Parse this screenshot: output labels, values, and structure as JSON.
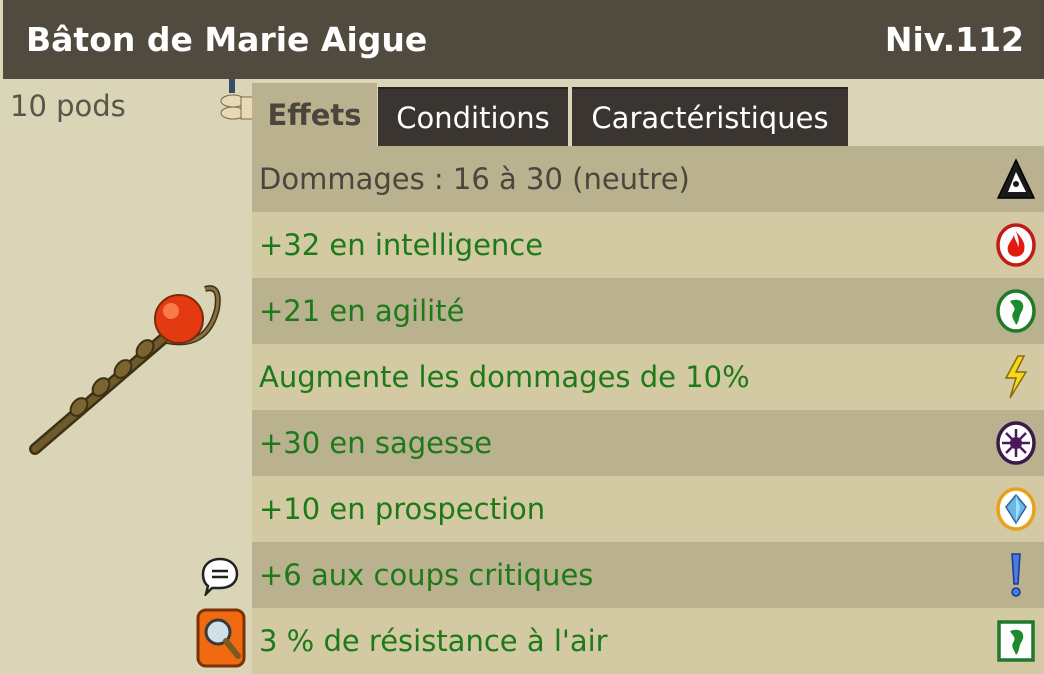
{
  "item": {
    "name": "Bâton de Marie Aigue",
    "level": "Niv.112",
    "weight": "10 pods"
  },
  "tabs": [
    {
      "label": "Effets",
      "active": true
    },
    {
      "label": "Conditions",
      "active": false
    },
    {
      "label": "Caractéristiques",
      "active": false
    }
  ],
  "effects": [
    {
      "text": "Dommages : 16 à 30 (neutre)",
      "icon": "neutral-element-icon"
    },
    {
      "text": "+32 en intelligence",
      "icon": "fire-element-icon"
    },
    {
      "text": "+21 en agilité",
      "icon": "air-element-icon"
    },
    {
      "text": "Augmente les dommages de 10%",
      "icon": "lightning-damage-icon"
    },
    {
      "text": "+30 en sagesse",
      "icon": "wisdom-icon"
    },
    {
      "text": "+10 en prospection",
      "icon": "prospecting-icon"
    },
    {
      "text": "+6 aux coups critiques",
      "icon": "critical-exclamation-icon"
    },
    {
      "text": "3 % de résistance à l'air",
      "icon": "air-resistance-icon"
    }
  ],
  "colors": {
    "title_bg": "#514a3e",
    "panel_bg": "#d9d5b6",
    "row_odd": "#bab18f",
    "row_even": "#d3c9a3",
    "effect_text": "#1e7a19"
  }
}
